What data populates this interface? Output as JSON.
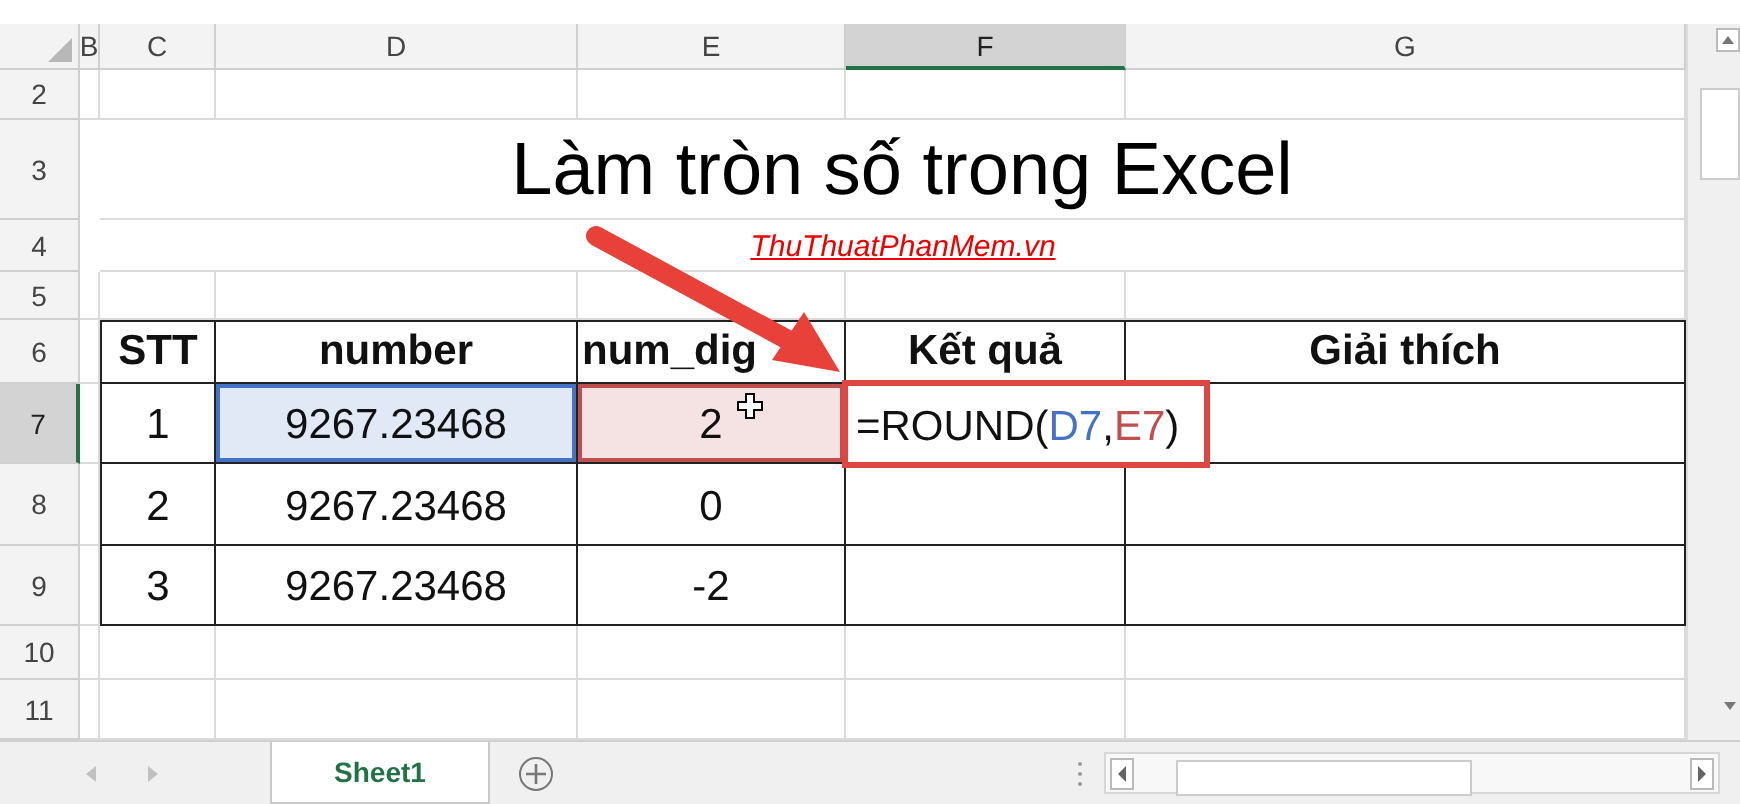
{
  "columns": [
    {
      "label": "B",
      "selected": false
    },
    {
      "label": "C",
      "selected": false
    },
    {
      "label": "D",
      "selected": false
    },
    {
      "label": "E",
      "selected": false
    },
    {
      "label": "F",
      "selected": true
    },
    {
      "label": "G",
      "selected": false
    }
  ],
  "rows": [
    {
      "label": "2",
      "selected": false
    },
    {
      "label": "3",
      "selected": false
    },
    {
      "label": "4",
      "selected": false
    },
    {
      "label": "5",
      "selected": false
    },
    {
      "label": "6",
      "selected": false
    },
    {
      "label": "7",
      "selected": true
    },
    {
      "label": "8",
      "selected": false
    },
    {
      "label": "9",
      "selected": false
    },
    {
      "label": "10",
      "selected": false
    },
    {
      "label": "11",
      "selected": false
    }
  ],
  "title": "Làm tròn số trong Excel",
  "link": "ThuThuatPhanMem.vn",
  "table": {
    "columns": [
      "STT",
      "number",
      "num_dig",
      "Kết quả",
      "Giải thích"
    ],
    "rows": [
      {
        "cells": [
          {
            "kind": "value",
            "text": "1"
          },
          {
            "kind": "value",
            "text": "9267.23468",
            "color": "#4472c4"
          },
          {
            "kind": "value",
            "text": "2",
            "color": "#c0504d"
          },
          {
            "kind": "formula",
            "parts": [
              {
                "text": "=ROUND("
              },
              {
                "text": "D7",
                "color": "#4472c4"
              },
              {
                "text": ","
              },
              {
                "text": "E7",
                "color": "#c0504d"
              },
              {
                "text": ")"
              }
            ]
          }
        ]
      },
      {
        "cells": [
          {
            "kind": "value",
            "text": "2"
          },
          {
            "kind": "value",
            "text": "9267.23468"
          },
          {
            "kind": "value",
            "text": "0"
          }
        ]
      },
      {
        "cells": [
          {
            "kind": "value",
            "text": "3"
          },
          {
            "kind": "value",
            "text": "9267.23468"
          },
          {
            "kind": "value",
            "text": "-2"
          }
        ]
      }
    ]
  },
  "sheet_tabs": [
    {
      "label": "Sheet1",
      "selected": true
    }
  ]
}
